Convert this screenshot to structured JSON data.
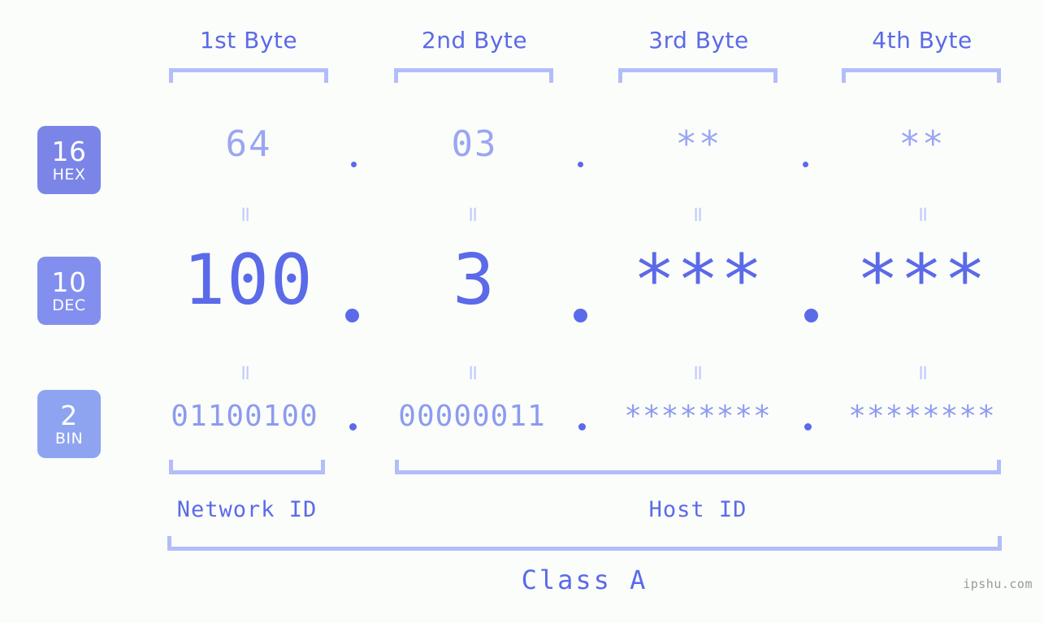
{
  "background_color": "#fbfdfa",
  "accent_color": "#5b6ae8",
  "bracket_color": "#b3bdfa",
  "headers": [
    {
      "label": "1st Byte"
    },
    {
      "label": "2nd Byte"
    },
    {
      "label": "3rd Byte"
    },
    {
      "label": "4th Byte"
    }
  ],
  "bases": [
    {
      "number": "16",
      "name": "HEX",
      "color": "#7b85e8"
    },
    {
      "number": "10",
      "name": "DEC",
      "color": "#838fee"
    },
    {
      "number": "2",
      "name": "BIN",
      "color": "#8ea4f0"
    }
  ],
  "rows": {
    "hex": {
      "values": [
        "64",
        "03",
        "**",
        "**"
      ]
    },
    "dec": {
      "values": [
        "100",
        "3",
        "***",
        "***"
      ]
    },
    "bin": {
      "values": [
        "01100100",
        "00000011",
        "********",
        "********"
      ]
    }
  },
  "separator": ".",
  "equality_mark": "=",
  "sections": {
    "network_id": "Network ID",
    "host_id": "Host ID",
    "class": "Class A"
  },
  "watermark": "ipshu.com"
}
